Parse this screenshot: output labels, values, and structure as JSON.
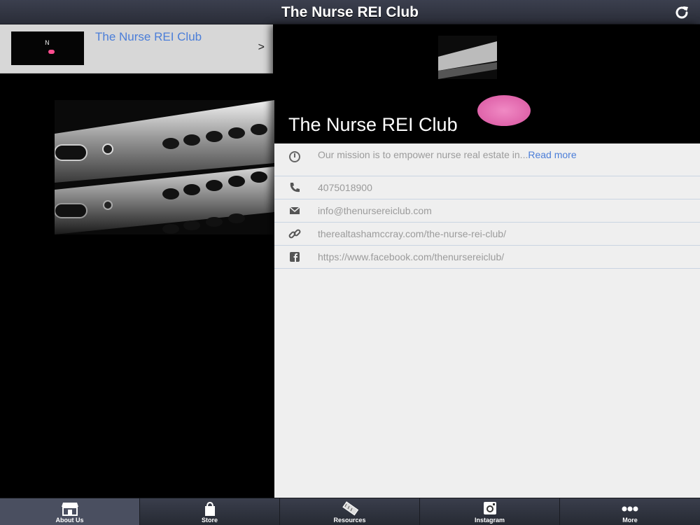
{
  "header": {
    "title": "The Nurse REI Club",
    "refresh_icon": "refresh-icon"
  },
  "list": {
    "items": [
      {
        "label": "The Nurse REI Club",
        "thumb_text": "N"
      }
    ]
  },
  "detail": {
    "title": "The Nurse REI Club",
    "mission": "Our mission is to empower nurse real estate in...",
    "read_more": "Read more",
    "phone": "4075018900",
    "email": "info@thenursereiclub.com",
    "website": "therealtashamccray.com/the-nurse-rei-club/",
    "facebook": "https://www.facebook.com/thenursereiclub/"
  },
  "tabs": [
    {
      "label": "About Us",
      "icon": "store-icon",
      "active": true
    },
    {
      "label": "Store",
      "icon": "bag-icon",
      "active": false
    },
    {
      "label": "Resources",
      "icon": "pencil-icon",
      "active": false
    },
    {
      "label": "Instagram",
      "icon": "instagram-icon",
      "active": false
    },
    {
      "label": "More",
      "icon": "more-icon",
      "active": false
    }
  ],
  "colors": {
    "accent": "#4b7ed8",
    "logo_pink": "#e06aae",
    "header": "#2f3340"
  }
}
